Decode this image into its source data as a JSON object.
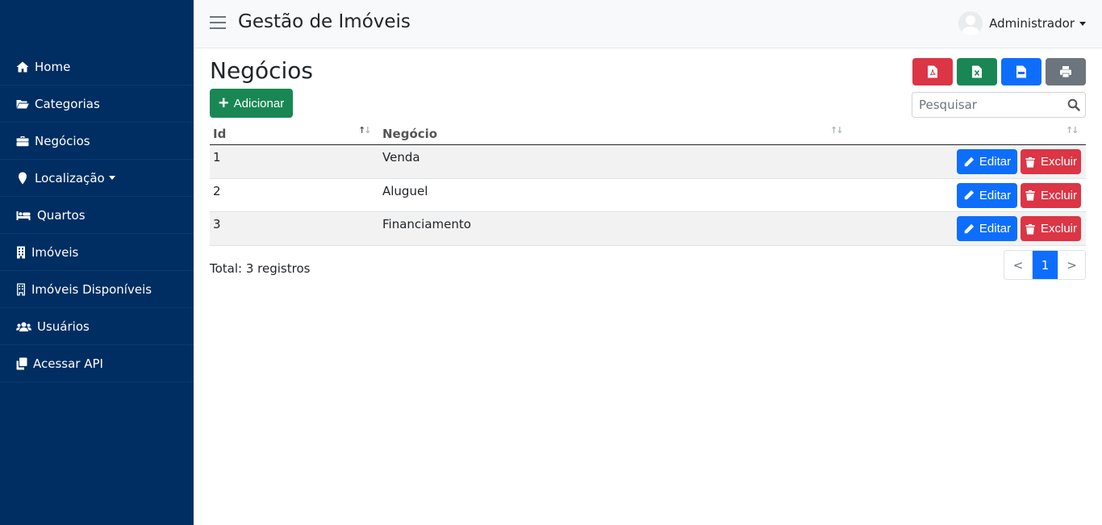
{
  "app": {
    "title": "Gestão de Imóveis"
  },
  "user": {
    "name": "Administrador"
  },
  "sidebar": {
    "items": [
      {
        "label": "Home",
        "icon": "home-icon"
      },
      {
        "label": "Categorias",
        "icon": "folder-open-icon"
      },
      {
        "label": "Negócios",
        "icon": "briefcase-icon"
      },
      {
        "label": "Localização",
        "icon": "map-marker-icon",
        "dropdown": true
      },
      {
        "label": "Quartos",
        "icon": "bed-icon"
      },
      {
        "label": "Imóveis",
        "icon": "building-icon"
      },
      {
        "label": "Imóveis Disponíveis",
        "icon": "building-icon"
      },
      {
        "label": "Usuários",
        "icon": "users-icon"
      },
      {
        "label": "Acessar API",
        "icon": "clone-icon"
      }
    ]
  },
  "page": {
    "title": "Negócios",
    "add_label": "Adicionar",
    "search_placeholder": "Pesquisar",
    "exports": [
      "pdf-file-icon",
      "excel-file-icon",
      "csv-file-icon",
      "print-icon"
    ]
  },
  "table": {
    "columns": [
      "Id",
      "Negócio"
    ],
    "rows": [
      {
        "id": "1",
        "name": "Venda"
      },
      {
        "id": "2",
        "name": "Aluguel"
      },
      {
        "id": "3",
        "name": "Financiamento"
      }
    ],
    "edit_label": "Editar",
    "delete_label": "Excluir"
  },
  "footer": {
    "total": "Total: 3 registros",
    "pagination": {
      "prev": "<",
      "current": "1",
      "next": ">"
    }
  },
  "colors": {
    "sidebar": "#002e62",
    "primary": "#0d6efd",
    "success": "#198754",
    "danger": "#dc3545",
    "secondary": "#6c757d"
  }
}
